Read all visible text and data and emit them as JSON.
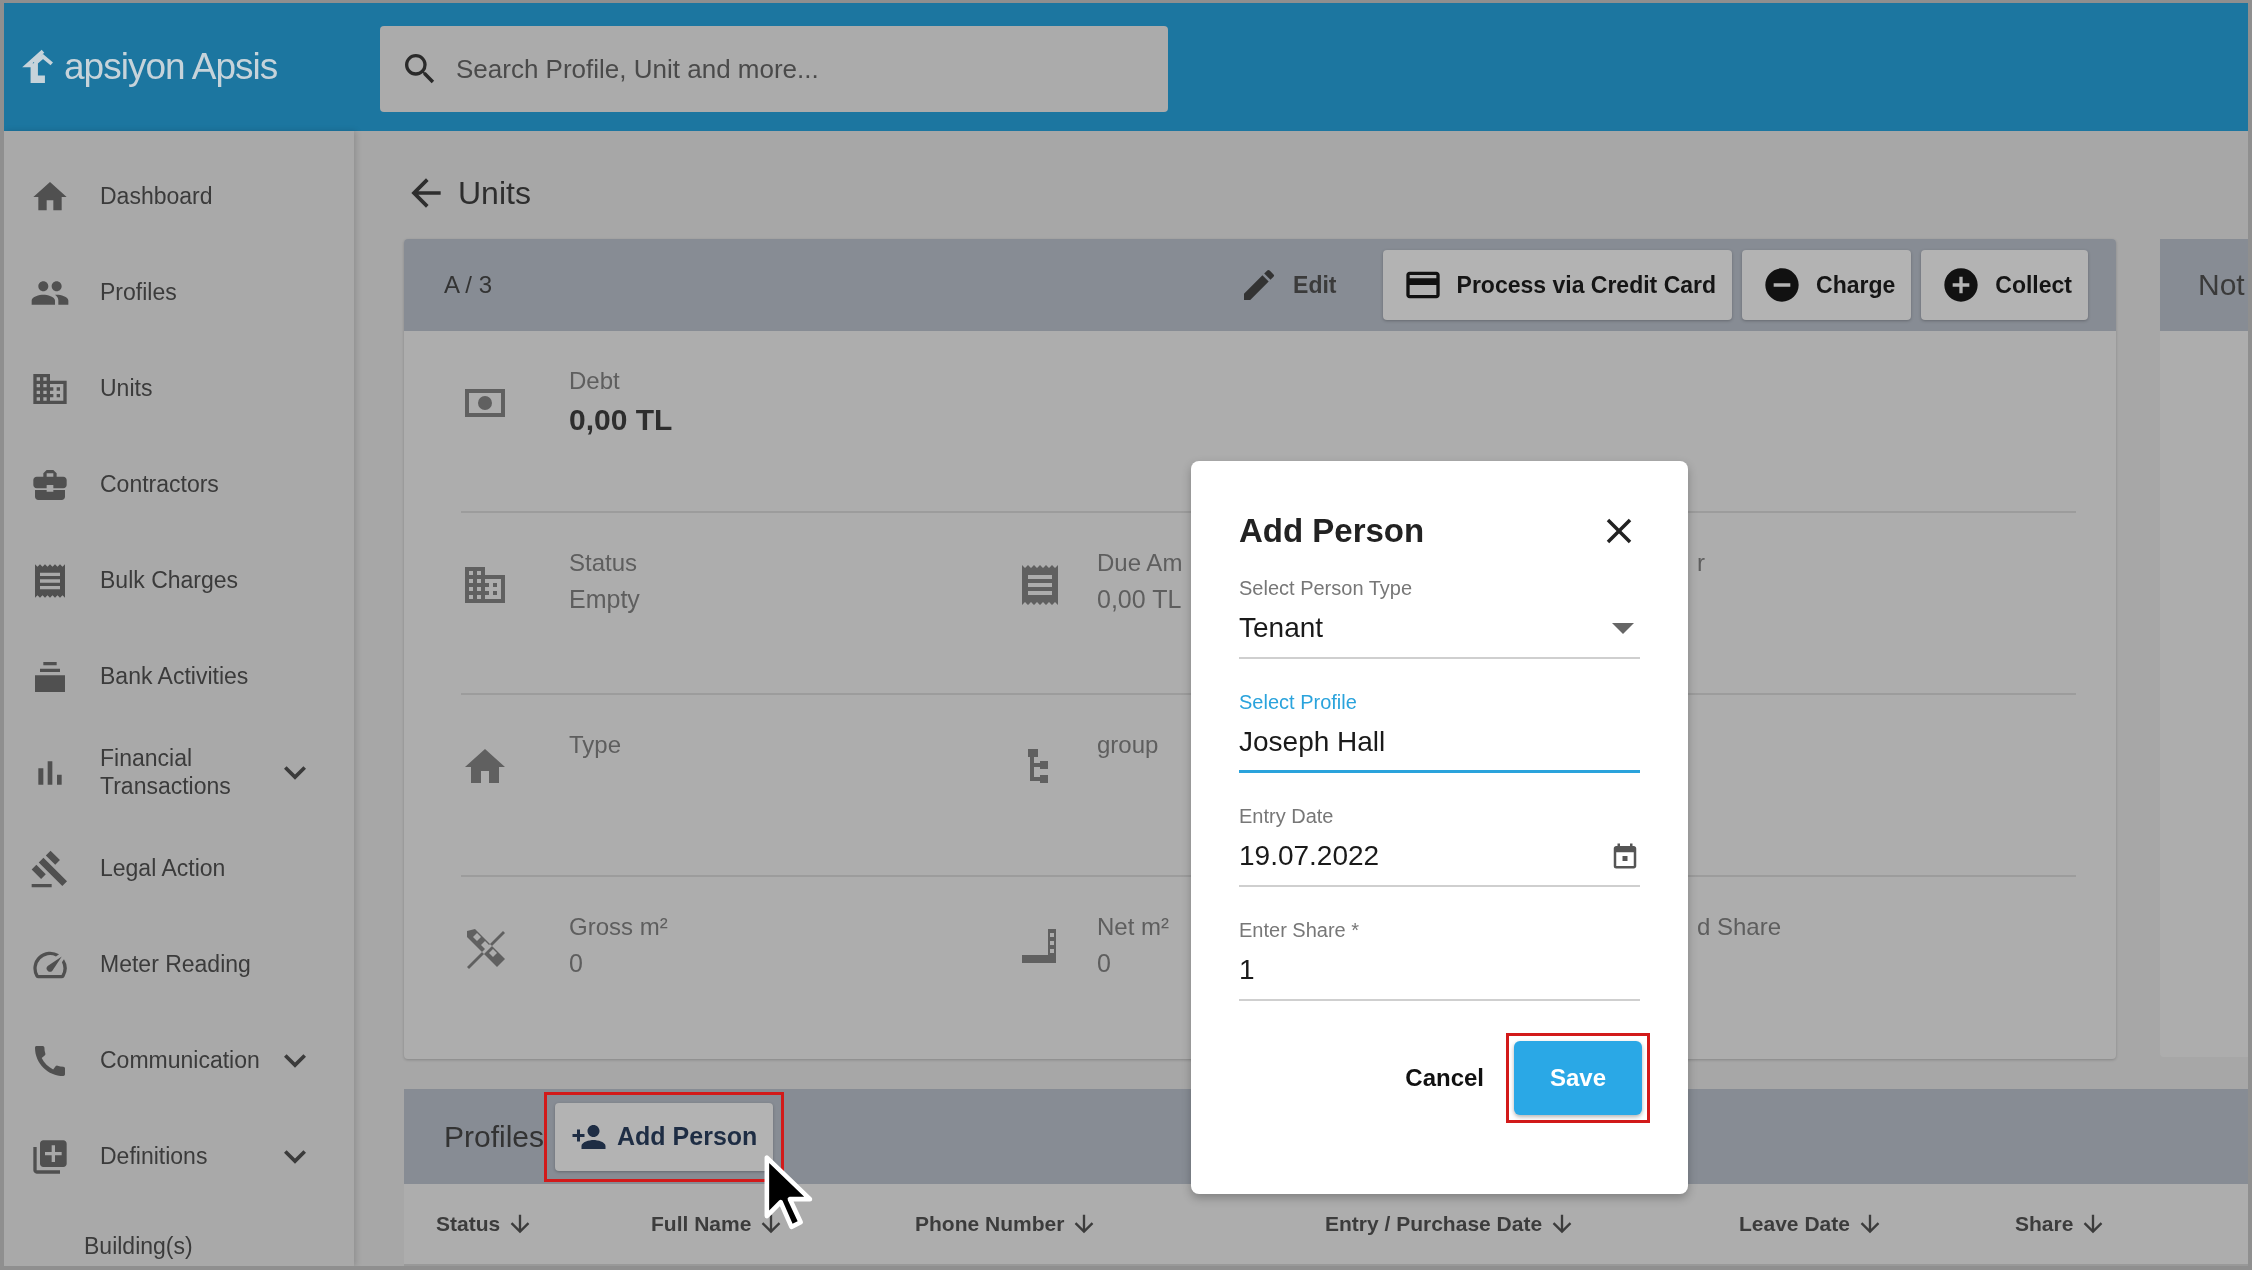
{
  "header": {
    "logo": "apsiyon Apsis",
    "search": {
      "placeholder": "Search Profile, Unit and more..."
    }
  },
  "sidebar": {
    "items": [
      {
        "label": "Dashboard",
        "kind": "link"
      },
      {
        "label": "Profiles",
        "kind": "link"
      },
      {
        "label": "Units",
        "kind": "link"
      },
      {
        "label": "Contractors",
        "kind": "link"
      },
      {
        "label": "Bulk Charges",
        "kind": "link"
      },
      {
        "label": "Bank Activities",
        "kind": "link"
      },
      {
        "label": "Financial Transactions",
        "kind": "group"
      },
      {
        "label": "Legal Action",
        "kind": "link"
      },
      {
        "label": "Meter Reading",
        "kind": "link"
      },
      {
        "label": "Communication",
        "kind": "group"
      },
      {
        "label": "Definitions",
        "kind": "group"
      },
      {
        "label": "Building(s)",
        "kind": "subitem"
      }
    ]
  },
  "page": {
    "back_title": "Units"
  },
  "unit_card": {
    "title": "A / 3",
    "actions": [
      {
        "label": "Edit",
        "kind": "flat"
      },
      {
        "label": "Process via Credit Card",
        "kind": "raised"
      },
      {
        "label": "Charge",
        "kind": "raised"
      },
      {
        "label": "Collect",
        "kind": "raised"
      }
    ],
    "rows": [
      {
        "left": {
          "label": "Debt",
          "value": "0,00 TL",
          "kind": "amount"
        }
      },
      {
        "left": {
          "label": "Status",
          "value": "Empty",
          "kind": "plain"
        },
        "middle": {
          "label": "Due Am",
          "value": "0,00 TL",
          "kind": "plain"
        },
        "right": {
          "label": "r"
        }
      },
      {
        "left": {
          "label": "Type"
        },
        "middle": {
          "label": "group"
        }
      },
      {
        "left": {
          "label": "Gross m²",
          "value": "0",
          "kind": "plain"
        },
        "middle": {
          "label": "Net m²",
          "value": "0",
          "kind": "plain"
        },
        "right": {
          "label": "d Share"
        }
      }
    ]
  },
  "side_card": {
    "title": "Not"
  },
  "profiles": {
    "title": "Profiles",
    "add_button": {
      "label": "Add Person",
      "highlighted": true
    },
    "columns": [
      "Status",
      "Full Name",
      "Phone Number",
      "Entry / Purchase Date",
      "Leave Date",
      "Share"
    ]
  },
  "dialog": {
    "title": "Add Person",
    "fields": [
      {
        "kind": "select",
        "label": "Select Person Type",
        "value": "Tenant",
        "focused": false
      },
      {
        "kind": "text",
        "label": "Select Profile",
        "value": "Joseph Hall",
        "focused": true
      },
      {
        "kind": "date",
        "label": "Entry Date",
        "value": "19.07.2022",
        "focused": false
      },
      {
        "kind": "text",
        "label": "Enter Share *",
        "value": "1",
        "focused": false
      }
    ],
    "buttons": [
      {
        "label": "Cancel",
        "kind": "text",
        "highlighted": false
      },
      {
        "label": "Save",
        "kind": "primary",
        "highlighted": true
      }
    ]
  }
}
